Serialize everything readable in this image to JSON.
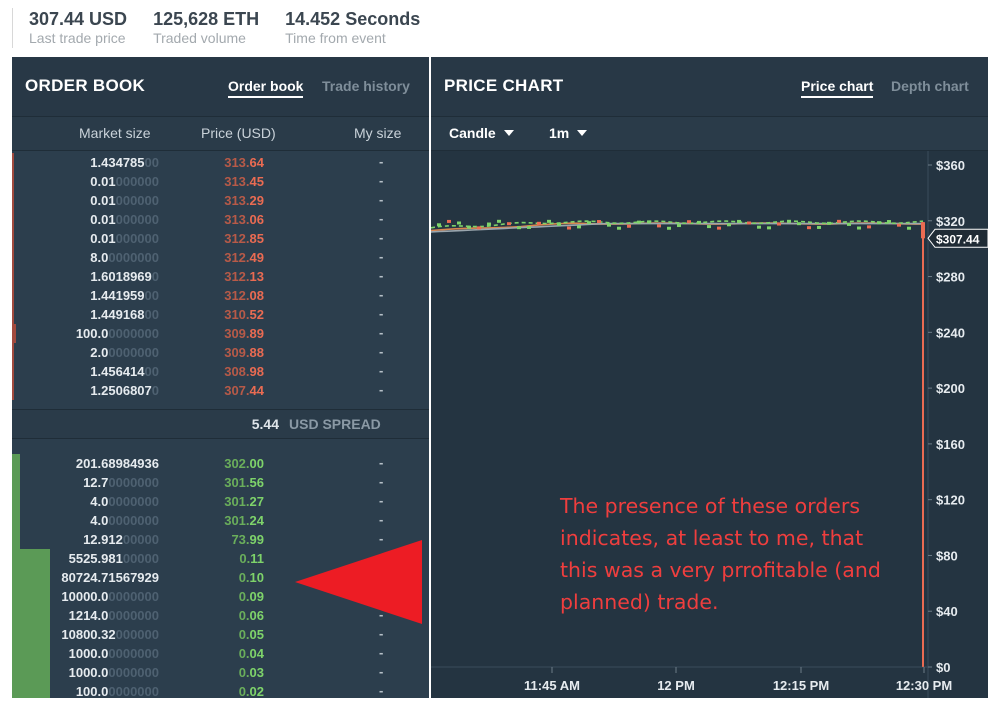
{
  "stats": [
    {
      "value": "307.44 USD",
      "label": "Last trade price"
    },
    {
      "value": "125,628 ETH",
      "label": "Traded volume"
    },
    {
      "value": "14.452 Seconds",
      "label": "Time from event"
    }
  ],
  "order_book": {
    "title": "ORDER BOOK",
    "tabs": [
      {
        "label": "Order book",
        "active": true
      },
      {
        "label": "Trade history",
        "active": false
      }
    ],
    "columns": {
      "market_size": "Market size",
      "price": "Price (USD)",
      "my_size": "My size"
    },
    "asks": [
      {
        "size": "1.434785",
        "dim": "00",
        "price": "313.",
        "price_end": "64",
        "mine": "-",
        "depth": 0.0
      },
      {
        "size": "0.01",
        "dim": "000000",
        "price": "313.",
        "price_end": "45",
        "mine": "-",
        "depth": 0.0
      },
      {
        "size": "0.01",
        "dim": "000000",
        "price": "313.",
        "price_end": "29",
        "mine": "-",
        "depth": 0.0
      },
      {
        "size": "0.01",
        "dim": "000000",
        "price": "313.",
        "price_end": "06",
        "mine": "-",
        "depth": 0.0
      },
      {
        "size": "0.01",
        "dim": "000000",
        "price": "312.",
        "price_end": "85",
        "mine": "-",
        "depth": 0.0
      },
      {
        "size": "8.0",
        "dim": "0000000",
        "price": "312.",
        "price_end": "49",
        "mine": "-",
        "depth": 0.0
      },
      {
        "size": "1.6018969",
        "dim": "0",
        "price": "312.",
        "price_end": "13",
        "mine": "-",
        "depth": 0.0
      },
      {
        "size": "1.441959",
        "dim": "00",
        "price": "312.",
        "price_end": "08",
        "mine": "-",
        "depth": 0.0
      },
      {
        "size": "1.449168",
        "dim": "00",
        "price": "310.",
        "price_end": "52",
        "mine": "-",
        "depth": 0.0
      },
      {
        "size": "100.0",
        "dim": "0000000",
        "price": "309.",
        "price_end": "89",
        "mine": "-",
        "depth": 0.01
      },
      {
        "size": "2.0",
        "dim": "0000000",
        "price": "309.",
        "price_end": "88",
        "mine": "-",
        "depth": 0.0
      },
      {
        "size": "1.456414",
        "dim": "00",
        "price": "308.",
        "price_end": "98",
        "mine": "-",
        "depth": 0.0
      },
      {
        "size": "1.2506807",
        "dim": "0",
        "price": "307.",
        "price_end": "44",
        "mine": "-",
        "depth": 0.0
      }
    ],
    "spread": {
      "value": "5.44",
      "label": "USD SPREAD"
    },
    "bids": [
      {
        "size": "201.68984936",
        "dim": "",
        "price": "302.",
        "price_end": "00",
        "mine": "-",
        "depth": 0.02
      },
      {
        "size": "12.7",
        "dim": "0000000",
        "price": "301.",
        "price_end": "56",
        "mine": "-",
        "depth": 0.02
      },
      {
        "size": "4.0",
        "dim": "0000000",
        "price": "301.",
        "price_end": "27",
        "mine": "-",
        "depth": 0.02
      },
      {
        "size": "4.0",
        "dim": "0000000",
        "price": "301.",
        "price_end": "24",
        "mine": "-",
        "depth": 0.02
      },
      {
        "size": "12.912",
        "dim": "00000",
        "price": "73.",
        "price_end": "99",
        "mine": "-",
        "depth": 0.02
      },
      {
        "size": "5525.981",
        "dim": "00000",
        "price": "0.",
        "price_end": "11",
        "mine": "-",
        "depth": 0.09
      },
      {
        "size": "80724.71567929",
        "dim": "",
        "price": "0.",
        "price_end": "10",
        "mine": "-",
        "depth": 0.09
      },
      {
        "size": "10000.0",
        "dim": "0000000",
        "price": "0.",
        "price_end": "09",
        "mine": "-",
        "depth": 0.09
      },
      {
        "size": "1214.0",
        "dim": "0000000",
        "price": "0.",
        "price_end": "06",
        "mine": "-",
        "depth": 0.09
      },
      {
        "size": "10800.32",
        "dim": "000000",
        "price": "0.",
        "price_end": "05",
        "mine": "-",
        "depth": 0.09
      },
      {
        "size": "1000.0",
        "dim": "0000000",
        "price": "0.",
        "price_end": "04",
        "mine": "-",
        "depth": 0.09
      },
      {
        "size": "1000.0",
        "dim": "0000000",
        "price": "0.",
        "price_end": "03",
        "mine": "-",
        "depth": 0.09
      },
      {
        "size": "100.0",
        "dim": "0000000",
        "price": "0.",
        "price_end": "02",
        "mine": "-",
        "depth": 0.09
      }
    ]
  },
  "price_chart": {
    "title": "PRICE CHART",
    "tabs": [
      {
        "label": "Price chart",
        "active": true
      },
      {
        "label": "Depth chart",
        "active": false
      }
    ],
    "chart_type_select": "Candle",
    "interval_select": "1m",
    "y_ticks": [
      "$360",
      "$320",
      "$280",
      "$240",
      "$200",
      "$160",
      "$120",
      "$80",
      "$40",
      "$0"
    ],
    "x_ticks": [
      "11:45 AM",
      "12 PM",
      "12:15 PM",
      "12:30 PM"
    ],
    "last_price_tag": "$307.44"
  },
  "chart_data": {
    "type": "line",
    "x": [
      "11:45 AM",
      "12 PM",
      "12:15 PM",
      "12:30 PM"
    ],
    "ylim": [
      0,
      360
    ],
    "series": [
      {
        "values": [
          318,
          319,
          319,
          319
        ]
      }
    ],
    "last_price": 307.44,
    "crash_low": 0.1
  },
  "annotation": {
    "text": "The presence of these orders indicates, at least to me, that this was a very prrofitable (and planned) trade.",
    "color": "#ef3e3e"
  },
  "colors": {
    "ask": "#ea6b52",
    "bid": "#7ed36a",
    "panel": "#2c3e4d",
    "depth_bar": "#5b9a56"
  }
}
